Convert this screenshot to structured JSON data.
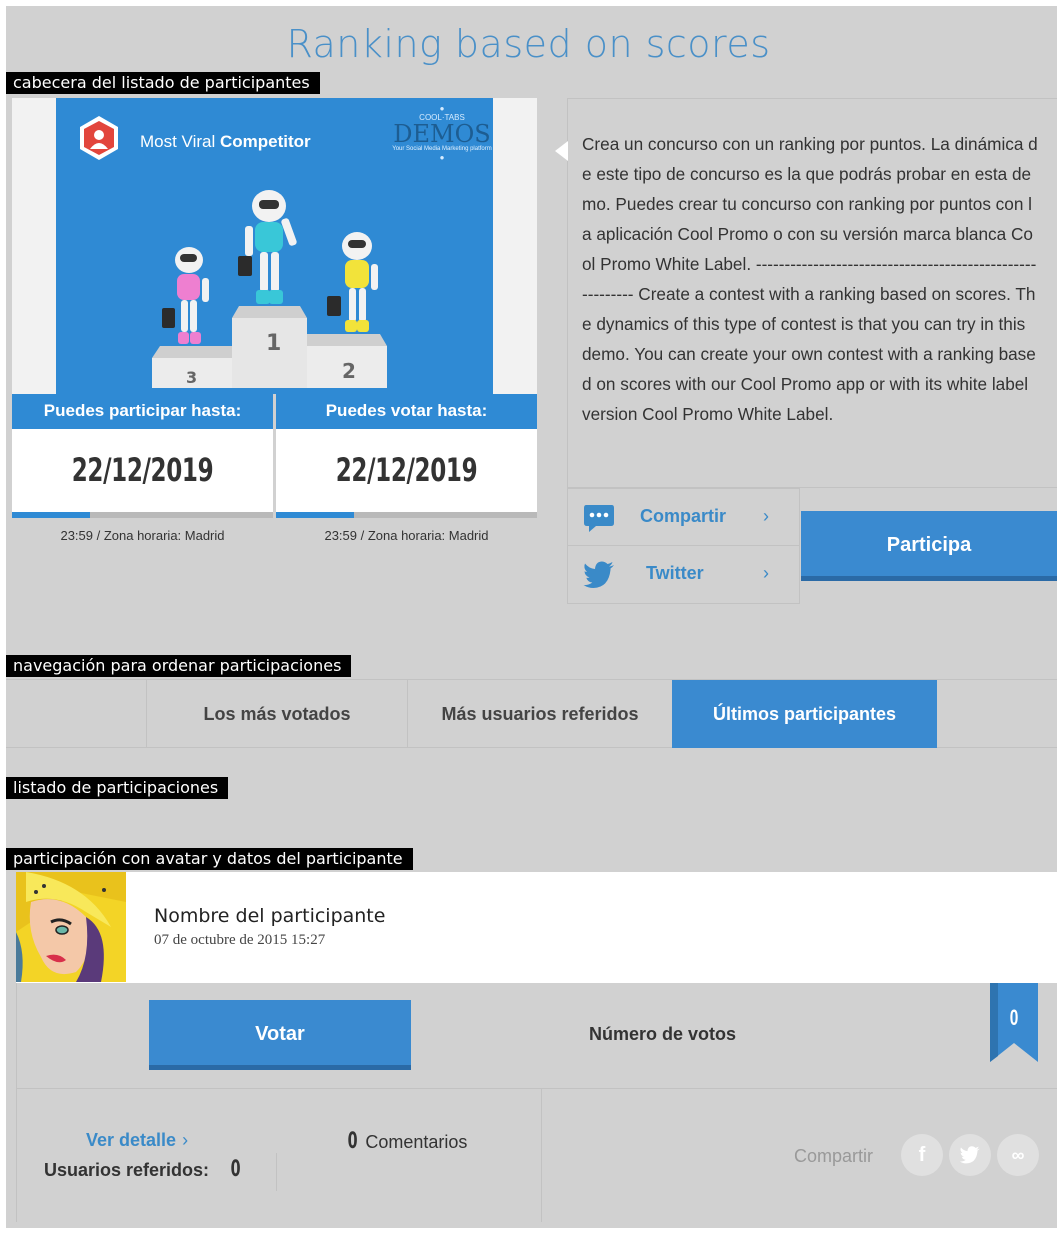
{
  "page_title": "Ranking based on scores",
  "tags": {
    "header": "cabecera del listado de participantes",
    "nav": "navegación para ordenar participaciones",
    "list": "listado de participaciones",
    "entry": "participación con avatar y datos del participante"
  },
  "banner": {
    "brand_light": "Most Viral",
    "brand_bold": "Competitor",
    "cool_label": "COOL·TABS",
    "demos_label": "DEMOS",
    "demos_sub": "Your Social Media Marketing platform",
    "podium_first": "1",
    "podium_second": "2",
    "podium_third": "3"
  },
  "dates": {
    "participate_label": "Puedes participar hasta:",
    "participate_date": "22/12/2019",
    "participate_progress": 0.3,
    "vote_label": "Puedes votar hasta:",
    "vote_date": "22/12/2019",
    "vote_progress": 0.3,
    "timezone_participate": "23:59 / Zona horaria: Madrid",
    "timezone_vote": "23:59 / Zona horaria: Madrid"
  },
  "description": "Crea un concurso con un ranking por puntos. La dinámica de este tipo de concurso es la que podrás probar en esta demo. Puedes crear tu concurso con ranking por puntos con la aplicación Cool Promo o con su versión marca blanca Cool Promo White Label. ---------------------------------------------------------- Create a contest with a ranking based on scores. The dynamics of this type of contest is that you can try in this demo. You can create your own contest with a ranking based on scores with our Cool Promo app or with its white label version Cool Promo White Label.",
  "share": {
    "compartir_label": "Compartir",
    "twitter_label": "Twitter",
    "chevron": "›",
    "participa_label": "Participa"
  },
  "nav": {
    "tabs": [
      {
        "label": "Los más votados",
        "active": false
      },
      {
        "label": "Más usuarios referidos",
        "active": false
      },
      {
        "label": "Últimos participantes",
        "active": true
      }
    ]
  },
  "entry": {
    "name": "Nombre del participante",
    "date": "07 de octubre de 2015 15:27",
    "vote_label": "Votar",
    "votes_label": "Número de votos",
    "votes_count": "0",
    "detail_label": "Ver detalle",
    "detail_chevron": "›",
    "comments_count": "0",
    "comments_label": "Comentarios",
    "referred_label": "Usuarios referidos:",
    "referred_count": "0",
    "share_label": "Compartir",
    "share_icons": [
      "facebook-icon",
      "twitter-icon",
      "link-icon"
    ]
  },
  "colors": {
    "accent": "#3a8ad0",
    "background": "#d1d1d1",
    "tag_bg": "#000000"
  }
}
